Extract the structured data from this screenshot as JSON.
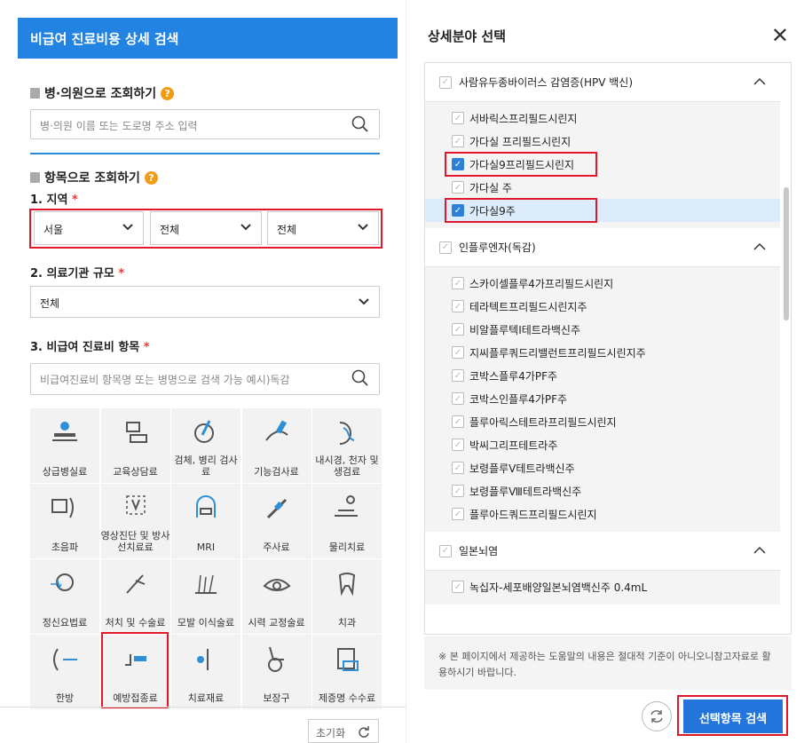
{
  "left": {
    "header": "비급여 진료비용 상세 검색",
    "hospital_search": {
      "title": "병·의원으로 조회하기",
      "placeholder": "병·의원 이름 또는 도로명 주소 입력"
    },
    "item_search": {
      "title": "항목으로 조회하기"
    },
    "region": {
      "label": "1. 지역",
      "required": "*",
      "select1": "서울",
      "select2": "전체",
      "select3": "전체"
    },
    "scale": {
      "label": "2. 의료기관 규모",
      "required": "*",
      "value": "전체"
    },
    "item": {
      "label": "3. 비급여 진료비 항목",
      "required": "*",
      "placeholder": "비급여진료비 항목명 또는 병명으로 검색 가능 예시)독감"
    },
    "categories": [
      {
        "name": "상급병실료",
        "icon": "bed-icon"
      },
      {
        "name": "교육상담료",
        "icon": "counsel-icon"
      },
      {
        "name": "검체, 병리 검사료",
        "icon": "test-tube-icon"
      },
      {
        "name": "기능검사료",
        "icon": "function-test-icon"
      },
      {
        "name": "내시경, 천자 및 생검료",
        "icon": "endoscope-icon"
      },
      {
        "name": "초음파",
        "icon": "ultrasound-icon"
      },
      {
        "name": "영상진단 및 방사선치료료",
        "icon": "radiology-icon"
      },
      {
        "name": "MRI",
        "icon": "mri-icon"
      },
      {
        "name": "주사료",
        "icon": "syringe-icon"
      },
      {
        "name": "물리치료",
        "icon": "physio-icon"
      },
      {
        "name": "정신요법료",
        "icon": "brain-icon"
      },
      {
        "name": "처치 및 수술료",
        "icon": "scalpel-icon"
      },
      {
        "name": "모발 이식술료",
        "icon": "hair-icon"
      },
      {
        "name": "시력 교정술료",
        "icon": "eye-icon"
      },
      {
        "name": "치과",
        "icon": "tooth-icon"
      },
      {
        "name": "한방",
        "icon": "acupuncture-icon"
      },
      {
        "name": "예방접종료",
        "icon": "vaccine-icon"
      },
      {
        "name": "치료재료",
        "icon": "material-icon"
      },
      {
        "name": "보장구",
        "icon": "wheelchair-icon"
      },
      {
        "name": "제증명 수수료",
        "icon": "certificate-icon"
      }
    ],
    "reset": "초기화"
  },
  "right": {
    "title": "상세분야 선택",
    "groups": [
      {
        "name": "사람유두종바이러스 감염증(HPV 백신)",
        "items": [
          {
            "label": "서바릭스프리필드시린지",
            "checked": false
          },
          {
            "label": "가다실 프리필드시린지",
            "checked": false
          },
          {
            "label": "가다실9프리필드시린지",
            "checked": true
          },
          {
            "label": "가다실 주",
            "checked": false
          },
          {
            "label": "가다실9주",
            "checked": true
          }
        ]
      },
      {
        "name": "인플루엔자(독감)",
        "items": [
          {
            "label": "스카이셀플루4가프리필드시린지",
            "checked": false
          },
          {
            "label": "테라텍트프리필드시린지주",
            "checked": false
          },
          {
            "label": "비알플루텍I테트라백신주",
            "checked": false
          },
          {
            "label": "지씨플루쿼드리밸런트프리필드시린지주",
            "checked": false
          },
          {
            "label": "코박스플루4가PF주",
            "checked": false
          },
          {
            "label": "코박스인플루4가PF주",
            "checked": false
          },
          {
            "label": "플루아릭스테트라프리필드시린지",
            "checked": false
          },
          {
            "label": "박씨그리프테트라주",
            "checked": false
          },
          {
            "label": "보령플루V테트라백신주",
            "checked": false
          },
          {
            "label": "보령플루Ⅷ테트라백신주",
            "checked": false
          },
          {
            "label": "플루아드쿼드프리필드시린지",
            "checked": false
          }
        ]
      },
      {
        "name": "일본뇌염",
        "items": [
          {
            "label": "녹십자-세포배양일본뇌염백신주 0.4mL",
            "checked": false
          }
        ]
      }
    ],
    "notice": "※ 본 페이지에서 제공하는 도움말의 내용은 절대적 기준이 아니오니참고자료로 활용하시기 바랍니다.",
    "search_button": "선택항목 검색",
    "colors": {
      "primary": "#2375dc",
      "highlight": "#e3172c"
    }
  }
}
